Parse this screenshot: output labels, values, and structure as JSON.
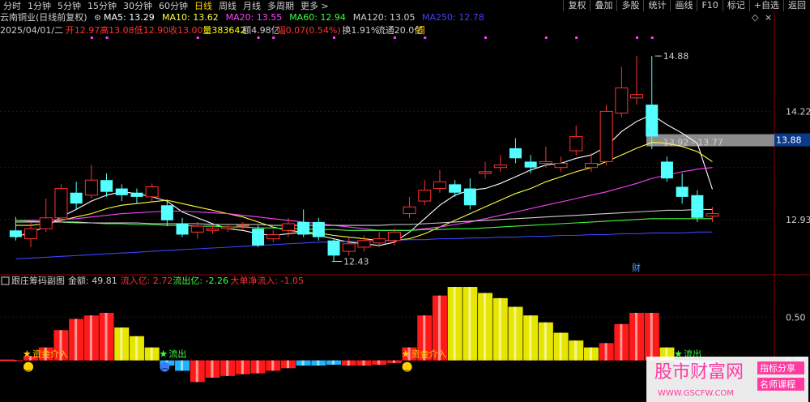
{
  "toolbar": {
    "periods": [
      "分时",
      "1分钟",
      "5分钟",
      "15分钟",
      "30分钟",
      "60分钟",
      "日线",
      "周线",
      "月线",
      "多周期",
      "更多 >"
    ],
    "active_period_index": 6,
    "right_buttons": [
      "复权",
      "叠加",
      "多股",
      "统计",
      "画线",
      "F10",
      "标记",
      "+自选",
      "返回"
    ]
  },
  "header": {
    "stock_name": "云南铜业(日线前复权)",
    "ma": [
      {
        "label": "MA5: 13.29",
        "color": "#ffffff"
      },
      {
        "label": "MA10: 13.62",
        "color": "#ffff40"
      },
      {
        "label": "MA20: 13.55",
        "color": "#ff40ff"
      },
      {
        "label": "MA60: 12.94",
        "color": "#40ff40"
      },
      {
        "label": "MA120: 13.05",
        "color": "#cfcfcf"
      },
      {
        "label": "MA250: 12.78",
        "color": "#4040ff"
      }
    ],
    "quote": [
      {
        "text": "2025/04/01/二",
        "color": "#cfcfcf"
      },
      {
        "text": "开12.97",
        "color": "#ff3232"
      },
      {
        "text": "高13.08",
        "color": "#ff3232"
      },
      {
        "text": "低12.90",
        "color": "#ff3232"
      },
      {
        "text": "收13.00",
        "color": "#ff3232"
      },
      {
        "text": "量383642",
        "color": "#ffff00"
      },
      {
        "text": "额4.98亿",
        "color": "#cfcfcf"
      },
      {
        "text": "幅0.07(0.54%)",
        "color": "#ff3232"
      },
      {
        "text": "换1.91%",
        "color": "#cfcfcf"
      },
      {
        "text": "流通20.0亿",
        "color": "#cfcfcf"
      },
      {
        "text": "铜",
        "color": "#ffd200"
      }
    ]
  },
  "chart_data": {
    "type": "candlestick",
    "price_axis": {
      "ticks": [
        "14.22",
        "12.93"
      ],
      "current": "13.88",
      "range": [
        12.3,
        15.2
      ]
    },
    "candles": [
      [
        12.8,
        12.72,
        12.96,
        12.68
      ],
      [
        12.7,
        12.82,
        12.9,
        12.6
      ],
      [
        12.82,
        12.95,
        13.18,
        12.78
      ],
      [
        12.95,
        13.3,
        13.35,
        12.9
      ],
      [
        13.25,
        13.12,
        13.38,
        13.05
      ],
      [
        13.22,
        13.4,
        13.58,
        13.18
      ],
      [
        13.4,
        13.26,
        13.48,
        13.2
      ],
      [
        13.3,
        13.22,
        13.35,
        13.15
      ],
      [
        13.25,
        13.2,
        13.3,
        13.12
      ],
      [
        13.2,
        13.32,
        13.36,
        13.15
      ],
      [
        13.1,
        12.92,
        13.15,
        12.85
      ],
      [
        12.88,
        12.75,
        12.95,
        12.72
      ],
      [
        12.78,
        12.85,
        12.9,
        12.7
      ],
      [
        12.8,
        12.82,
        12.86,
        12.76
      ],
      [
        12.82,
        12.84,
        12.88,
        12.78
      ],
      [
        12.85,
        12.86,
        12.9,
        12.8
      ],
      [
        12.82,
        12.62,
        12.86,
        12.6
      ],
      [
        12.7,
        12.75,
        12.8,
        12.66
      ],
      [
        12.8,
        12.88,
        12.95,
        12.72
      ],
      [
        12.9,
        12.75,
        13.05,
        12.72
      ],
      [
        12.9,
        12.72,
        12.95,
        12.68
      ],
      [
        12.68,
        12.5,
        12.7,
        12.43
      ],
      [
        12.55,
        12.64,
        12.72,
        12.5
      ],
      [
        12.6,
        12.68,
        12.74,
        12.55
      ],
      [
        12.65,
        12.7,
        12.78,
        12.6
      ],
      [
        12.68,
        12.78,
        12.82,
        12.62
      ],
      [
        13.0,
        13.08,
        13.2,
        12.95
      ],
      [
        13.15,
        13.28,
        13.4,
        13.1
      ],
      [
        13.3,
        13.38,
        13.52,
        13.25
      ],
      [
        13.35,
        13.25,
        13.4,
        13.2
      ],
      [
        13.3,
        13.1,
        13.42,
        13.05
      ],
      [
        13.48,
        13.5,
        13.62,
        13.42
      ],
      [
        13.55,
        13.58,
        13.7,
        13.5
      ],
      [
        13.78,
        13.66,
        13.9,
        13.6
      ],
      [
        13.62,
        13.55,
        13.7,
        13.48
      ],
      [
        13.6,
        13.62,
        13.8,
        13.55
      ],
      [
        13.55,
        13.6,
        13.68,
        13.5
      ],
      [
        13.75,
        13.92,
        14.05,
        13.7
      ],
      [
        13.55,
        13.6,
        13.72,
        13.5
      ],
      [
        13.62,
        14.22,
        14.3,
        13.58
      ],
      [
        14.2,
        14.5,
        14.75,
        14.15
      ],
      [
        14.38,
        14.42,
        14.88,
        14.3
      ],
      [
        14.3,
        13.92,
        14.88,
        13.77
      ],
      [
        13.62,
        13.42,
        13.68,
        13.38
      ],
      [
        13.32,
        13.2,
        13.48,
        13.12
      ],
      [
        13.22,
        12.95,
        13.28,
        12.9
      ],
      [
        12.97,
        13.0,
        13.08,
        12.9
      ]
    ],
    "price_labels": [
      "14.88",
      "13.92 - 13.77",
      "12.43"
    ],
    "ma_series": [
      {
        "name": "MA5",
        "color": "#ffffff",
        "values": [
          12.72,
          12.78,
          12.84,
          12.96,
          13.05,
          13.15,
          13.22,
          13.26,
          13.24,
          13.2,
          13.15,
          13.02,
          12.95,
          12.88,
          12.82,
          12.8,
          12.76,
          12.74,
          12.76,
          12.78,
          12.74,
          12.7,
          12.66,
          12.64,
          12.62,
          12.66,
          12.78,
          12.94,
          13.1,
          13.22,
          13.28,
          13.3,
          13.36,
          13.44,
          13.52,
          13.58,
          13.6,
          13.66,
          13.7,
          13.8,
          13.98,
          14.1,
          14.18,
          14.06,
          13.96,
          13.84,
          13.29
        ]
      },
      {
        "name": "MA10",
        "color": "#ffff40",
        "values": [
          12.86,
          12.86,
          12.88,
          12.92,
          12.96,
          13.0,
          13.06,
          13.1,
          13.12,
          13.14,
          13.16,
          13.12,
          13.08,
          13.04,
          13.0,
          12.96,
          12.9,
          12.84,
          12.8,
          12.78,
          12.77,
          12.74,
          12.72,
          12.7,
          12.68,
          12.68,
          12.7,
          12.76,
          12.84,
          12.92,
          13.0,
          13.08,
          13.16,
          13.24,
          13.3,
          13.38,
          13.44,
          13.5,
          13.55,
          13.62,
          13.7,
          13.78,
          13.85,
          13.84,
          13.8,
          13.74,
          13.62
        ]
      },
      {
        "name": "MA20",
        "color": "#ff40ff",
        "values": [
          12.92,
          12.92,
          12.92,
          12.93,
          12.94,
          12.96,
          12.98,
          13.0,
          13.01,
          13.02,
          13.03,
          13.03,
          13.02,
          13.01,
          13.0,
          12.98,
          12.96,
          12.94,
          12.92,
          12.9,
          12.88,
          12.86,
          12.84,
          12.82,
          12.8,
          12.8,
          12.8,
          12.82,
          12.84,
          12.87,
          12.9,
          12.94,
          12.98,
          13.02,
          13.06,
          13.1,
          13.14,
          13.18,
          13.22,
          13.26,
          13.31,
          13.36,
          13.42,
          13.46,
          13.5,
          13.53,
          13.55
        ]
      },
      {
        "name": "MA60",
        "color": "#40ff40",
        "values": [
          12.92,
          12.91,
          12.9,
          12.9,
          12.89,
          12.89,
          12.88,
          12.88,
          12.87,
          12.87,
          12.86,
          12.86,
          12.85,
          12.85,
          12.84,
          12.84,
          12.83,
          12.83,
          12.82,
          12.82,
          12.81,
          12.81,
          12.8,
          12.8,
          12.8,
          12.8,
          12.8,
          12.81,
          12.81,
          12.82,
          12.82,
          12.83,
          12.84,
          12.85,
          12.86,
          12.87,
          12.88,
          12.89,
          12.9,
          12.91,
          12.92,
          12.93,
          12.94,
          12.94,
          12.94,
          12.94,
          12.94
        ]
      },
      {
        "name": "MA120",
        "color": "#cfcfcf",
        "values": [
          12.9,
          12.9,
          12.9,
          12.9,
          12.9,
          12.89,
          12.89,
          12.89,
          12.89,
          12.88,
          12.88,
          12.88,
          12.88,
          12.87,
          12.87,
          12.87,
          12.87,
          12.86,
          12.86,
          12.86,
          12.86,
          12.86,
          12.86,
          12.86,
          12.86,
          12.87,
          12.87,
          12.88,
          12.89,
          12.9,
          12.91,
          12.92,
          12.93,
          12.94,
          12.95,
          12.96,
          12.97,
          12.98,
          12.99,
          13.0,
          13.01,
          13.02,
          13.03,
          13.04,
          13.04,
          13.05,
          13.05
        ]
      },
      {
        "name": "MA250",
        "color": "#4040ff",
        "values": [
          12.46,
          12.47,
          12.48,
          12.49,
          12.5,
          12.51,
          12.52,
          12.53,
          12.54,
          12.55,
          12.56,
          12.57,
          12.58,
          12.59,
          12.6,
          12.61,
          12.62,
          12.63,
          12.64,
          12.65,
          12.66,
          12.66,
          12.67,
          12.67,
          12.68,
          12.68,
          12.69,
          12.69,
          12.7,
          12.7,
          12.71,
          12.71,
          12.72,
          12.72,
          12.73,
          12.73,
          12.74,
          12.74,
          12.75,
          12.75,
          12.76,
          12.76,
          12.77,
          12.77,
          12.77,
          12.78,
          12.78
        ]
      }
    ],
    "cai_label": "财",
    "indicator": {
      "title": "跟庄筹码副图",
      "fields": [
        {
          "text": "金额: 49.81",
          "color": "#cfcfcf"
        },
        {
          "text": "流入亿: 2.72",
          "color": "#ff3232"
        },
        {
          "text": "流出亿: -2.26",
          "color": "#40ff40"
        },
        {
          "text": "大单净流入: -1.05",
          "color": "#ff3232"
        }
      ],
      "ticks": [
        "0.50",
        "0.00"
      ],
      "range": [
        -0.35,
        0.85
      ],
      "bar_values": [
        0.0,
        0.05,
        0.15,
        0.35,
        0.48,
        0.52,
        0.55,
        0.38,
        0.28,
        0.15,
        -0.06,
        -0.12,
        -0.25,
        -0.2,
        -0.18,
        -0.16,
        -0.15,
        -0.12,
        -0.09,
        -0.06,
        -0.06,
        -0.05,
        -0.06,
        -0.06,
        -0.05,
        -0.03,
        0.15,
        0.52,
        0.75,
        0.85,
        0.85,
        0.78,
        0.72,
        0.62,
        0.52,
        0.44,
        0.32,
        0.23,
        0.15,
        0.2,
        0.42,
        0.55,
        0.55,
        0.15,
        -0.08,
        -0.16,
        -0.14
      ],
      "bar_colors": [
        "red",
        "red",
        "red",
        "red",
        "red",
        "red",
        "red",
        "yellow",
        "yellow",
        "yellow",
        "cyan",
        "cyan",
        "red",
        "red",
        "red",
        "red",
        "red",
        "red",
        "red",
        "cyan",
        "cyan",
        "cyan",
        "red",
        "red",
        "red",
        "red",
        "red",
        "red",
        "red",
        "yellow",
        "yellow",
        "yellow",
        "yellow",
        "yellow",
        "yellow",
        "yellow",
        "yellow",
        "yellow",
        "yellow",
        "red",
        "red",
        "red",
        "red",
        "yellow",
        "cyan",
        "cyan",
        "cyan"
      ],
      "signals": [
        {
          "index": 1,
          "label": "资金介入",
          "color": "#ffd200",
          "face": "happy"
        },
        {
          "index": 10,
          "label": "流出",
          "color": "#40ff40",
          "face": "sad"
        },
        {
          "index": 26,
          "label": "资金介入",
          "color": "#ffd200",
          "face": "happy"
        },
        {
          "index": 44,
          "label": "流出",
          "color": "#40ff40",
          "face": "sad"
        }
      ]
    }
  },
  "watermark": {
    "site": "股市财富网",
    "url": "WWW.GSCFW.COM",
    "tag1": "指标分享",
    "tag2": "名师课程"
  }
}
